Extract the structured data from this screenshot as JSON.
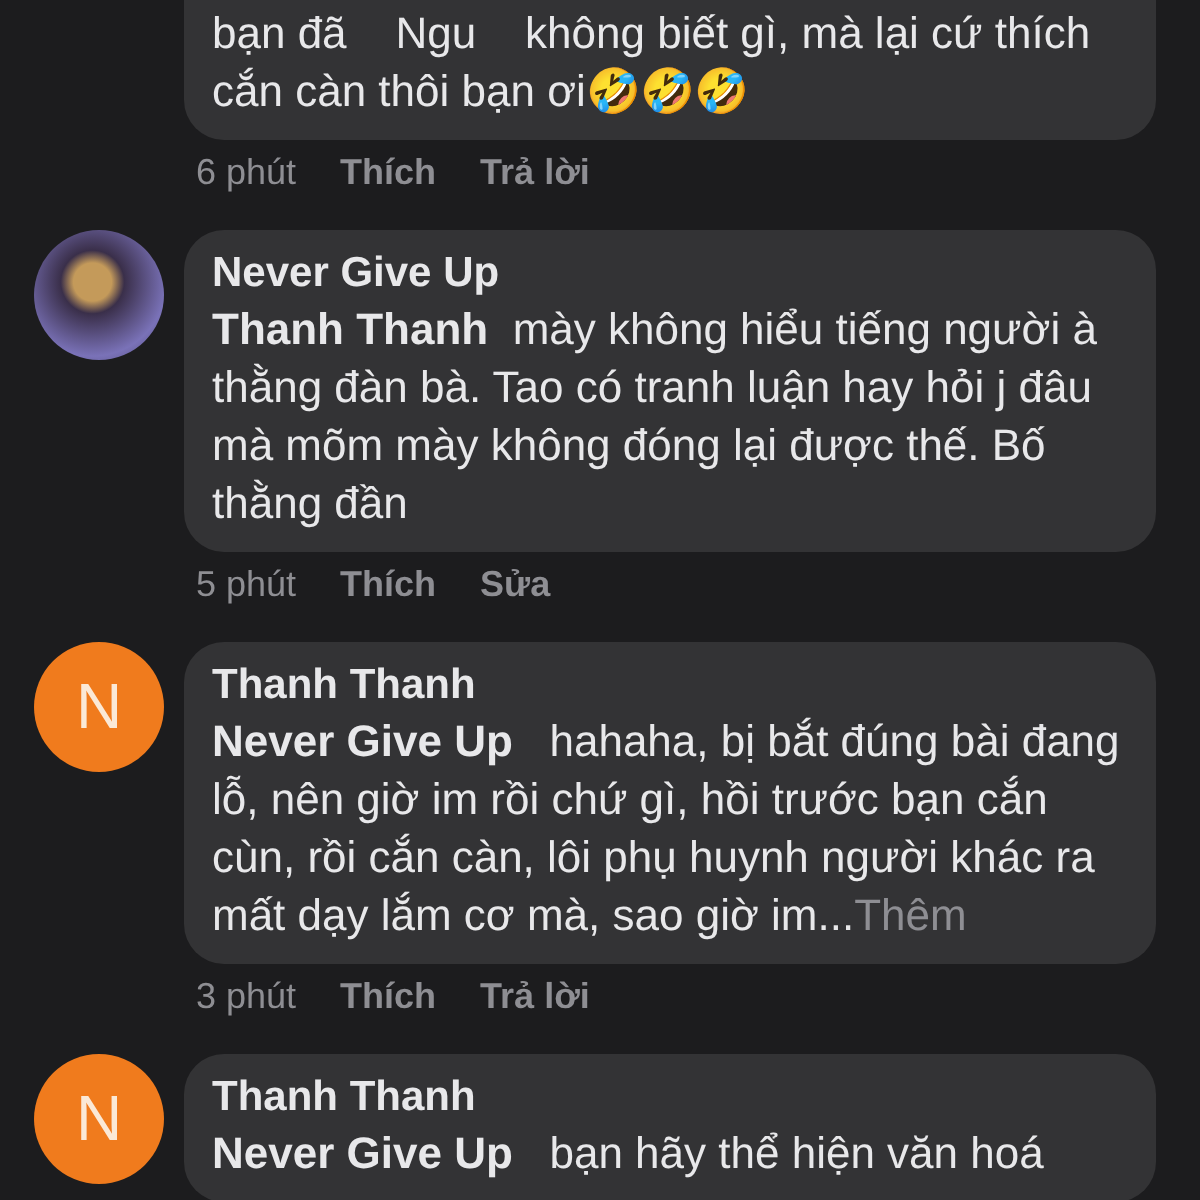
{
  "comments": [
    {
      "text": "bạn đã    Ngu    không biết gì, mà lại cứ thích cắn càn thôi bạn ơi🤣🤣🤣",
      "time": "6 phút",
      "actions": [
        "Thích",
        "Trả lời"
      ]
    },
    {
      "avatar": {
        "kind": "photo"
      },
      "author": "Never Give Up",
      "text": "**Thanh Thanh**  mày không hiểu tiếng người à thằng đàn bà. Tao có tranh luận hay hỏi j đâu mà mõm mày không đóng lại được thế. Bố thằng đần",
      "time": "5 phút",
      "actions": [
        "Thích",
        "Sửa"
      ]
    },
    {
      "avatar": {
        "kind": "letter",
        "letter": "N",
        "color": "#f07b1d"
      },
      "author": "Thanh Thanh",
      "text": "**Never Give Up**   hahaha, bị bắt đúng bài đang lỗ, nên giờ im rồi chứ gì, hồi trước bạn cắn cùn, rồi cắn càn, lôi phụ huynh người khác ra mất dạy lắm cơ mà, sao giờ im...",
      "more": "Thêm",
      "time": "3 phút",
      "actions": [
        "Thích",
        "Trả lời"
      ]
    },
    {
      "avatar": {
        "kind": "letter",
        "letter": "N",
        "color": "#f07b1d"
      },
      "author": "Thanh Thanh",
      "text": "**Never Give Up**   bạn hãy thể hiện văn hoá"
    }
  ]
}
